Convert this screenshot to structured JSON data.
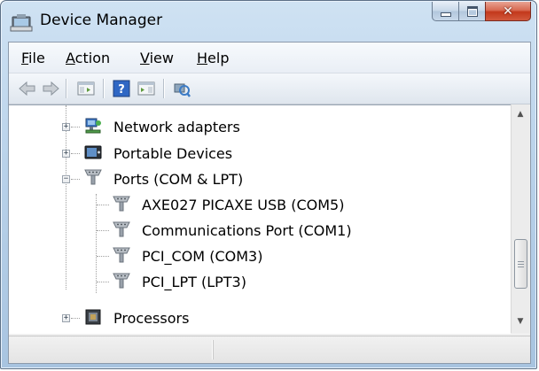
{
  "window": {
    "title": "Device Manager"
  },
  "menu": {
    "file": {
      "accel": "F",
      "rest": "ile"
    },
    "action": {
      "accel": "A",
      "rest": "ction"
    },
    "view": {
      "accel": "V",
      "rest": "iew"
    },
    "help": {
      "accel": "H",
      "rest": "elp"
    }
  },
  "toolbar": {
    "buttons": [
      "back-arrow-icon",
      "forward-arrow-icon",
      "show-hide-tree-icon",
      "help-icon",
      "properties-icon",
      "scan-hardware-icon"
    ]
  },
  "tree": {
    "nodes": [
      {
        "label": "Network adapters",
        "expanded": false,
        "icon": "network-adapter-icon"
      },
      {
        "label": "Portable Devices",
        "expanded": false,
        "icon": "portable-device-icon"
      },
      {
        "label": "Ports (COM & LPT)",
        "expanded": true,
        "icon": "port-connector-icon",
        "children": [
          {
            "label": "AXE027 PICAXE USB (COM5)",
            "icon": "port-connector-icon"
          },
          {
            "label": "Communications Port (COM1)",
            "icon": "port-connector-icon"
          },
          {
            "label": "PCI_COM (COM3)",
            "icon": "port-connector-icon"
          },
          {
            "label": "PCI_LPT (LPT3)",
            "icon": "port-connector-icon"
          }
        ]
      },
      {
        "label": "Processors",
        "expanded": false,
        "icon": "processor-chip-icon"
      }
    ]
  },
  "colors": {
    "titlebar": "#b9d2ea",
    "close_button": "#c3381b",
    "tree_background": "#ffffff"
  }
}
